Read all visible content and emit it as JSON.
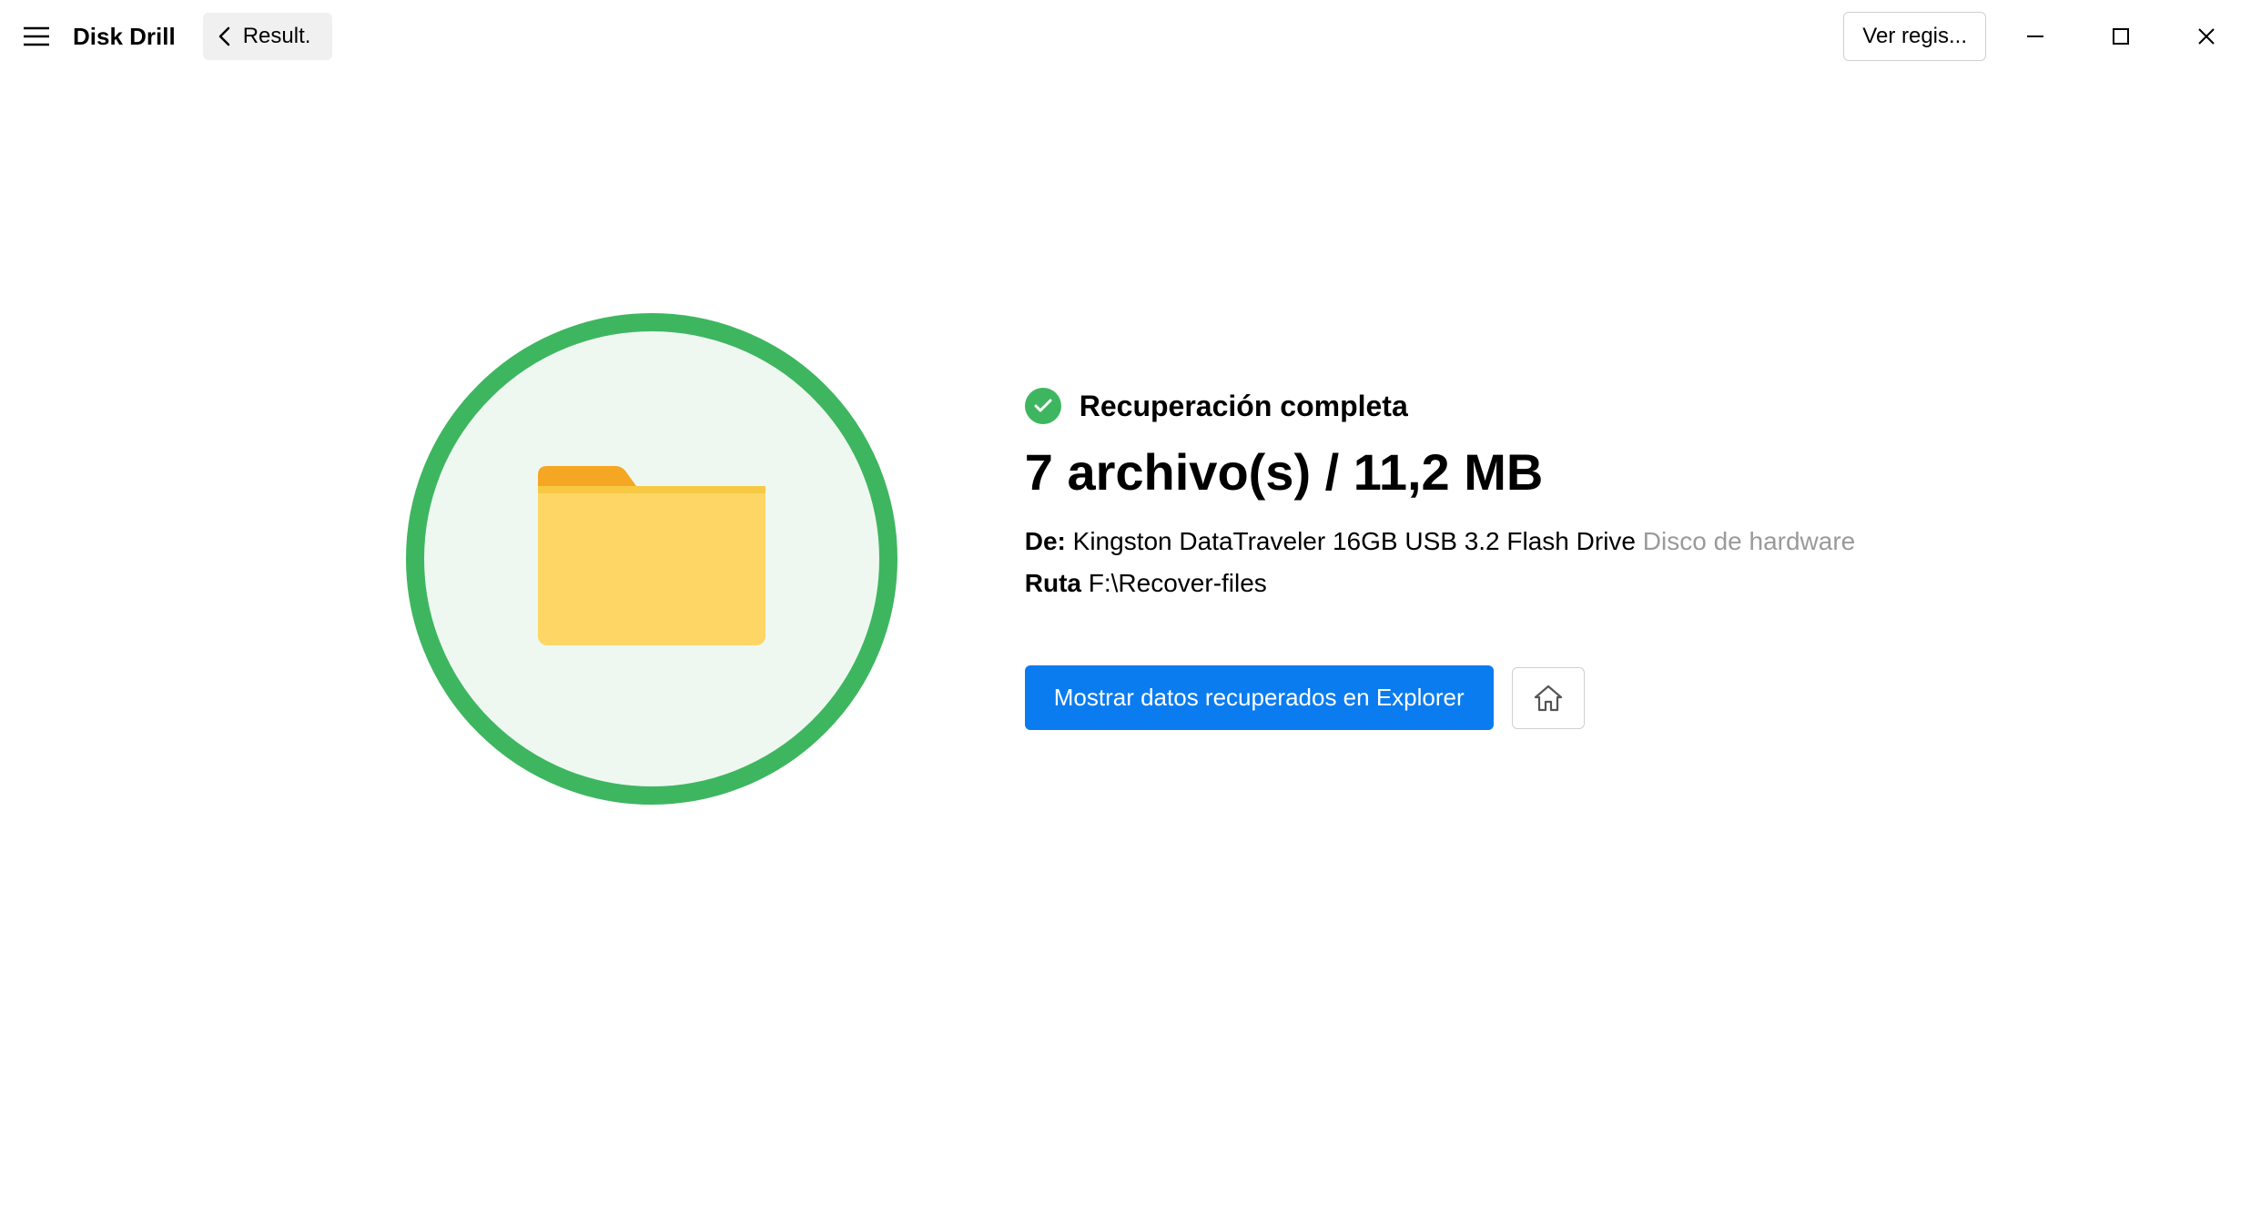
{
  "header": {
    "app_title": "Disk Drill",
    "back_label": "Result.",
    "log_button_label": "Ver regis..."
  },
  "main": {
    "status_text": "Recuperación completa",
    "file_summary": "7 archivo(s) / 11,2 MB",
    "source_label": "De:",
    "source_value": "Kingston DataTraveler 16GB USB 3.2 Flash Drive",
    "source_type": "Disco de hardware",
    "path_label": "Ruta",
    "path_value": "F:\\Recover-files",
    "show_button_label": "Mostrar datos recuperados en Explorer"
  }
}
